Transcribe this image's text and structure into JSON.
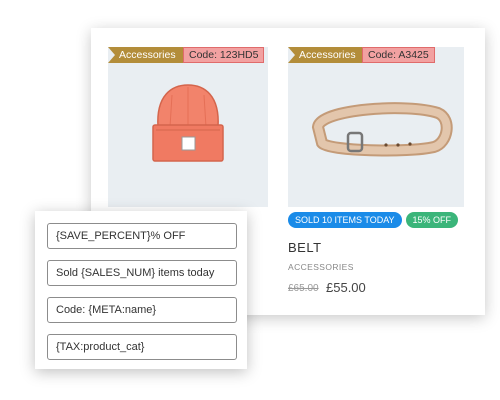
{
  "products": [
    {
      "category_tag": "Accessories",
      "code_tag": "Code: 123HD5",
      "image": "beanie-hat",
      "colors": {
        "tag": "#b38d3a",
        "code": "#f2a1a1",
        "item": "#f2836b"
      }
    },
    {
      "category_tag": "Accessories",
      "code_tag": "Code: A3425",
      "image": "leather-belt",
      "badges": {
        "sold": "SOLD 10 ITEMS TODAY",
        "discount": "15% OFF"
      },
      "name": "BELT",
      "category": "ACCESSORIES",
      "old_price": "£65.00",
      "price": "£55.00",
      "colors": {
        "sold_badge": "#1a8be8",
        "off_badge": "#3bb57a",
        "item": "#d9b89a"
      }
    }
  ],
  "template_fields": [
    "{SAVE_PERCENT}% OFF",
    "Sold {SALES_NUM} items today",
    "Code: {META:name}",
    "{TAX:product_cat}"
  ]
}
